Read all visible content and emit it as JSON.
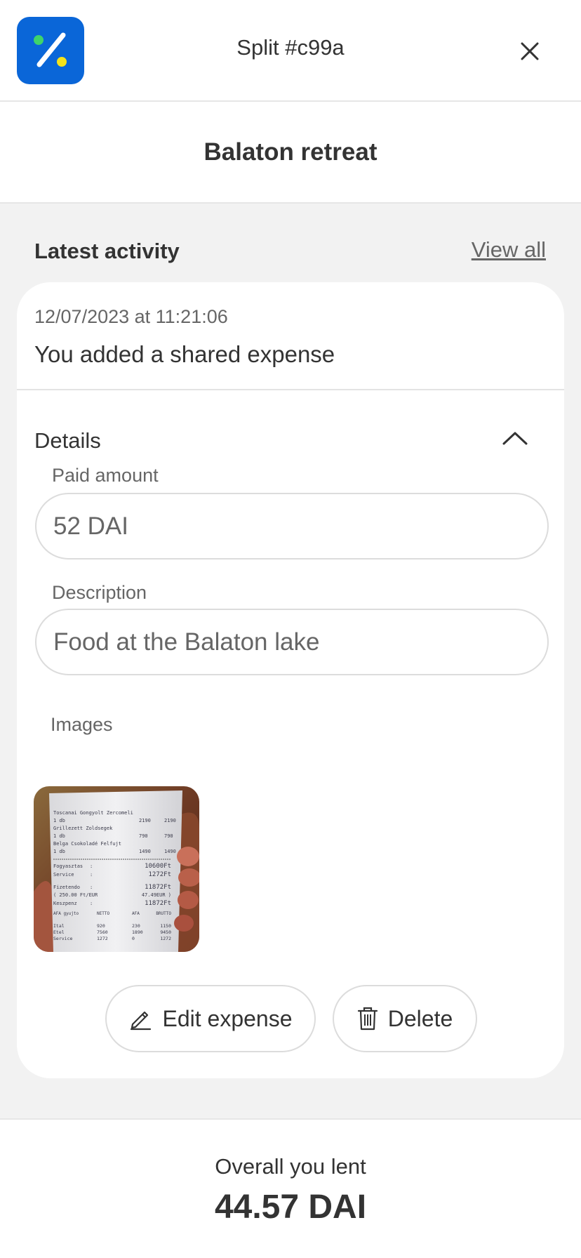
{
  "header": {
    "split_title": "Split #c99a",
    "logo_icon": "percent-icon",
    "close_icon": "close-icon",
    "brand_color": "#0a66d8",
    "logo_dot_colors": [
      "#3fd46a",
      "#f5e31a"
    ]
  },
  "group": {
    "title": "Balaton retreat"
  },
  "activity": {
    "section_title": "Latest activity",
    "view_all_label": "View all",
    "item": {
      "timestamp": "12/07/2023 at 11:21:06",
      "text": "You added a shared expense",
      "details_label": "Details",
      "details_expanded": true,
      "paid_amount_label": "Paid amount",
      "paid_amount_value": "52 DAI",
      "description_label": "Description",
      "description_value": "Food at the Balaton lake",
      "images_label": "Images",
      "edit_label": "Edit expense",
      "delete_label": "Delete",
      "receipt": {
        "rows": [
          [
            "Toscanai Gongyolt Zercomeli",
            "",
            ""
          ],
          [
            "1 db",
            "2190",
            "2190"
          ],
          [
            "Grillezett Zoldsegek",
            "",
            ""
          ],
          [
            "1 db",
            "790",
            "790"
          ],
          [
            "Belga Csokoladé Felfujt",
            "",
            ""
          ],
          [
            "1 db",
            "1490",
            "1490"
          ]
        ],
        "fogyasztas": [
          "Fogyasztas",
          ":",
          "10600Ft"
        ],
        "service": [
          "Service",
          ":",
          "1272Ft"
        ],
        "fizetendo": [
          "Fizetendo",
          ":",
          "11872Ft"
        ],
        "eur": [
          "( 250.00 Ft/EUR",
          "",
          "47.49EUR )"
        ],
        "keszpenz": [
          "Keszpenz",
          ":",
          "11872Ft"
        ],
        "afa_head": [
          "AFA gyujto",
          "NETTO",
          "AFA",
          "BRUTTO"
        ],
        "afa_rows": [
          [
            "Ital",
            "920",
            "230",
            "1150"
          ],
          [
            "Etel",
            "7560",
            "1890",
            "9450"
          ],
          [
            "Service",
            "1272",
            "0",
            "1272"
          ]
        ]
      }
    }
  },
  "footer": {
    "label": "Overall you lent",
    "amount": "44.57 DAI"
  }
}
